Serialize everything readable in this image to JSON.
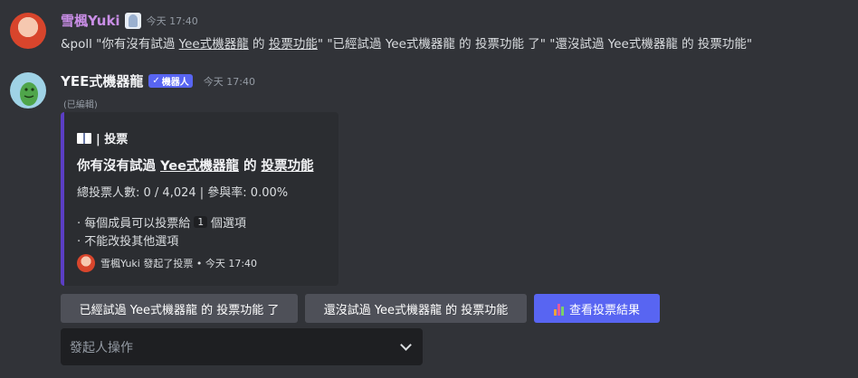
{
  "message1": {
    "username": "雪楓Yuki",
    "timestamp": "今天 17:40",
    "cmd_prefix": "&poll \"你有沒有試過 ",
    "cmd_u1": "Yee式機器龍",
    "cmd_mid": " 的 ",
    "cmd_u2": "投票功能",
    "cmd_rest": "\" \"已經試過 Yee式機器龍 的 投票功能 了\" \"還沒試過 Yee式機器龍 的 投票功能\""
  },
  "message2": {
    "username": "YEE式機器龍",
    "bot_tag": "機器人",
    "timestamp": "今天 17:40",
    "edited": "(已編輯)"
  },
  "embed": {
    "author": "| 投票",
    "title_prefix": "你有沒有試過 ",
    "title_u1": "Yee式機器龍",
    "title_mid": " 的 ",
    "title_u2": "投票功能",
    "stats": "總投票人數: 0 / 4,024 | 參與率: 0.00%",
    "rule1_prefix": "· 每個成員可以投票給",
    "rule1_num": "1",
    "rule1_suffix": "個選項",
    "rule2": "· 不能改投其他選項",
    "footer": "雪楓Yuki 發起了投票 • 今天 17:40"
  },
  "buttons": {
    "option1": "已經試過 Yee式機器龍 的 投票功能 了",
    "option2": "還沒試過 Yee式機器龍 的 投票功能",
    "results": "查看投票結果"
  },
  "select": {
    "placeholder": "發起人操作"
  },
  "colors": {
    "background": "#313338",
    "embed_accent": "#5b3ec4",
    "blurple": "#5865f2",
    "yuki_name": "#c98ee6"
  }
}
